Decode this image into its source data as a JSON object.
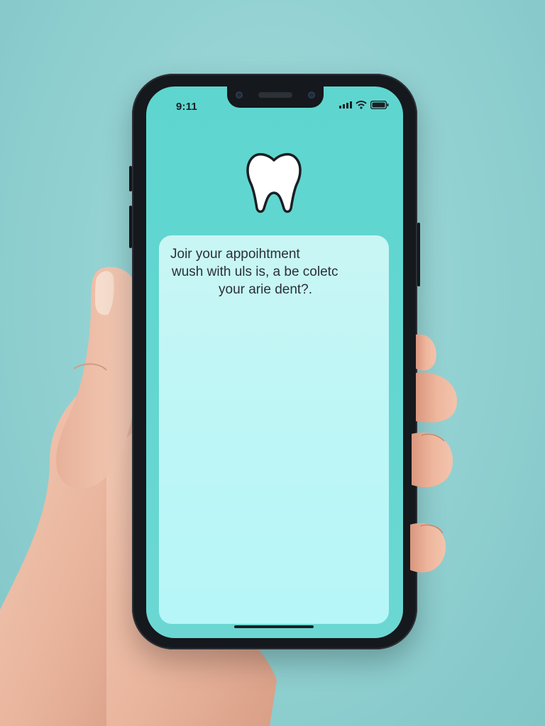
{
  "status_bar": {
    "time": "9:11"
  },
  "app": {
    "logo_icon": "tooth-icon",
    "message_lines": [
      "Joir your appoihtment",
      "wush with uls is, a be coletc",
      "your arie dent?."
    ]
  },
  "colors": {
    "background": "#8fcfd0",
    "screen": "#5ed6cf",
    "card": "#bff6f6",
    "phone_frame": "#15181c"
  }
}
